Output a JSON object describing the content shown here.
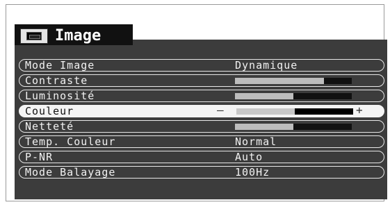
{
  "menu": {
    "title": "Image",
    "items": [
      {
        "label": "Mode Image",
        "type": "value",
        "value": "Dynamique"
      },
      {
        "label": "Contraste",
        "type": "bar",
        "level": 0.76
      },
      {
        "label": "Luminosité",
        "type": "bar",
        "level": 0.5
      },
      {
        "label": "Couleur",
        "type": "bar",
        "level": 0.5,
        "selected": true,
        "minus": "—",
        "plus": "+"
      },
      {
        "label": "Netteté",
        "type": "bar",
        "level": 0.5
      },
      {
        "label": "Temp. Couleur",
        "type": "value",
        "value": "Normal"
      },
      {
        "label": "P-NR",
        "type": "value",
        "value": "Auto"
      },
      {
        "label": "Mode Balayage",
        "type": "value",
        "value": "100Hz"
      }
    ]
  },
  "colors": {
    "panel_bg": "#3c3c3c",
    "selected_bg": "#f4f4f4",
    "bar_fill": "#bdbdbd",
    "bar_track": "#111111"
  },
  "icons": {
    "tab_icon": "screen-icon"
  }
}
